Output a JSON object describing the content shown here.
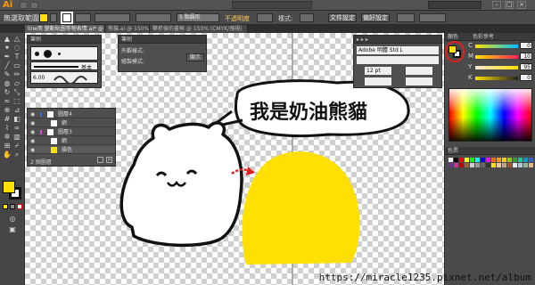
{
  "app": {
    "logo": "Ai"
  },
  "control": {
    "selection_label": "無選取範圍",
    "stroke_width": "5 點圓形",
    "opacity_label": "不透明度",
    "style_label": "樣式:",
    "doc_setup_button": "文件設定",
    "prefs_button": "偏好設定"
  },
  "tabs": [
    "line用 變動貼圖等物表情.ai* @ 66.67% (CMYK/預視)",
    "熊貓.ai @ 150% (CMYK/預...)",
    "攀抓後的畫框 @ 150% (CMYK/預視)"
  ],
  "brush_panel": {
    "title": "筆刷",
    "preset_label": "基本",
    "size_value": "6.00"
  },
  "appearance_panel": {
    "title": "筆刷",
    "row1": "外觀樣式:",
    "row2": "繪製模式:",
    "row3": "顯示"
  },
  "layers_panel": {
    "layers": [
      "圖層4",
      "網",
      "圖層3",
      "網",
      "描色"
    ],
    "footer": "2 個圖層"
  },
  "artwork": {
    "speech_text": "我是奶油熊貓",
    "fill_color": "#ffe000"
  },
  "char_panel": {
    "font_name": "Adobe 明體 Std L",
    "font_size": "12 pt"
  },
  "color_panel": {
    "title": "顏色",
    "guide_title": "色彩參考",
    "channels": [
      {
        "label": "C",
        "value": "0"
      },
      {
        "label": "M",
        "value": "10"
      },
      {
        "label": "Y",
        "value": "95"
      },
      {
        "label": "K",
        "value": "0"
      }
    ]
  },
  "swatch_panel": {
    "title": "色票"
  },
  "watermark": "https://miracle1235.pixnet.net/album",
  "colors": {
    "accent_yellow": "#ffe000",
    "ui_dark": "#4a4a4a"
  }
}
